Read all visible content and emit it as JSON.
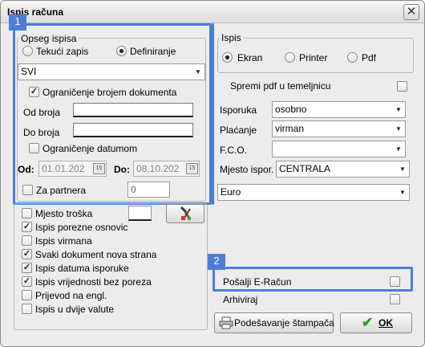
{
  "window": {
    "title": "Ispis računa",
    "close_glyph": "✕"
  },
  "badges": {
    "one": "1",
    "two": "2"
  },
  "opseg": {
    "group_label": "Opseg ispisa",
    "radio_tekuci": "Tekući zapis",
    "radio_definiranje": "Definiranje",
    "selected": "Definiranje",
    "scope_combo": "SVI",
    "limit_doc_label": "Ograničenje brojem dokumenta",
    "limit_doc_checked": true,
    "od_broja_label": "Od broja",
    "do_broja_label": "Do broja",
    "limit_date_label": "Ograničenje datumom",
    "limit_date_checked": false,
    "od_label": "Od:",
    "od_value": "01.01.202",
    "do_label": "Do:",
    "do_value": "08.10.202",
    "cal_glyph": "15",
    "partner_label": "Za partnera",
    "partner_checked": false,
    "partner_value": "0"
  },
  "options": [
    {
      "label": "Mjesto troška",
      "checked": false
    },
    {
      "label": "Ispis porezne osnovic",
      "checked": true
    },
    {
      "label": "Ispis virmana",
      "checked": false
    },
    {
      "label": "Svaki dokument nova strana",
      "checked": true
    },
    {
      "label": "Ispis datuma isporuke",
      "checked": true
    },
    {
      "label": "Ispis vrijednosti bez poreza",
      "checked": true
    },
    {
      "label": "Prijevod na engl.",
      "checked": false
    },
    {
      "label": "Ispis u dvije valute",
      "checked": false
    }
  ],
  "tools_icon": "tools-icon",
  "ispis": {
    "group_label": "Ispis",
    "radio_ekran": "Ekran",
    "radio_printer": "Printer",
    "radio_pdf": "Pdf",
    "selected": "Ekran",
    "spremi_pdf_label": "Spremi pdf u temeljnicu",
    "spremi_pdf_checked": false
  },
  "fields": {
    "isporuka_label": "Isporuka",
    "isporuka_value": "osobno",
    "placanje_label": "Plaćanje",
    "placanje_value": "virman",
    "fco_label": "F.C.O.",
    "fco_value": "",
    "mjesto_label": "Mjesto ispor.",
    "mjesto_value": "CENTRALA",
    "valuta_value": "Euro"
  },
  "posalji": {
    "label": "Pošalji E-Račun",
    "checked": false
  },
  "arhiviraj": {
    "label": "Arhiviraj",
    "checked": false
  },
  "buttons": {
    "podesavanje": "Podešavanje štampača",
    "ok": "OK",
    "check_glyph": "✔"
  },
  "check_glyph": "✓",
  "colors": {
    "highlight": "#4d7ed6",
    "ok_check": "#2a9a2a"
  }
}
